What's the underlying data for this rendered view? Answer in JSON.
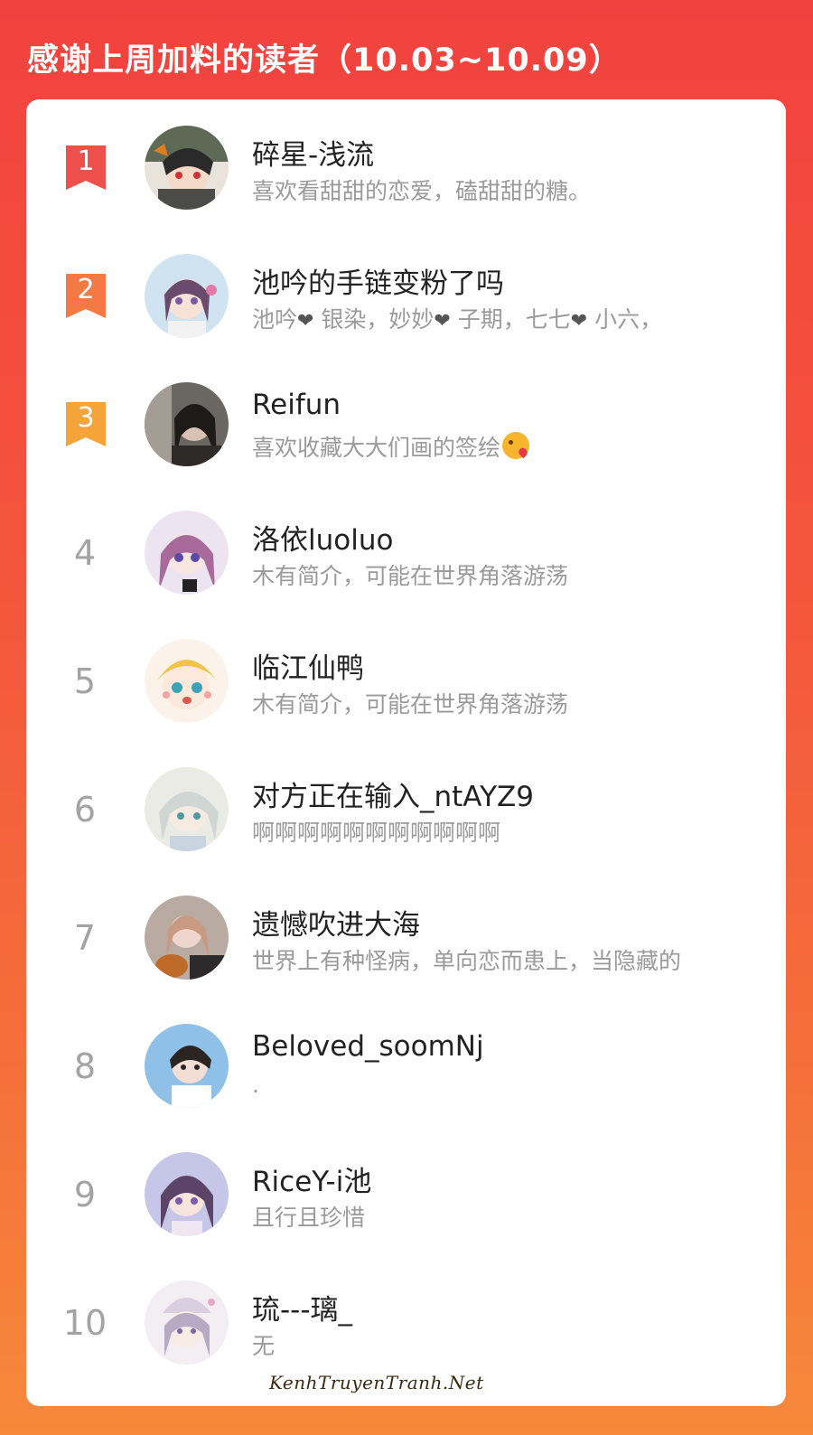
{
  "header": {
    "title": "感谢上周加料的读者（10.03~10.09）"
  },
  "colors": {
    "background_top": "#f2423f",
    "background_bottom": "#f7893a",
    "rank1": "#f0504c",
    "rank2": "#f37a45",
    "rank3": "#f5a43a",
    "name_text": "#222222",
    "desc_text": "#9a9a9a",
    "rank_text": "#a3a3a3"
  },
  "readers": [
    {
      "rank": "1",
      "name": "碎星-浅流",
      "desc": "喜欢看甜甜的恋爱，磕甜甜的糖。"
    },
    {
      "rank": "2",
      "name": "池吟的手链变粉了吗",
      "desc_parts": [
        "池吟",
        "❤",
        " 银染，妙妙",
        "❤",
        " 子期，七七",
        "❤",
        " 小六，"
      ]
    },
    {
      "rank": "3",
      "name": "Reifun",
      "desc": "喜欢收藏大大们画的签绘",
      "desc_emoji": "face-blowing-kiss-emoji"
    },
    {
      "rank": "4",
      "name": "洛依luoluo",
      "desc": "木有简介，可能在世界角落游荡"
    },
    {
      "rank": "5",
      "name": "临江仙鸭",
      "desc": "木有简介，可能在世界角落游荡"
    },
    {
      "rank": "6",
      "name": "对方正在输入_ntAYZ9",
      "desc": "啊啊啊啊啊啊啊啊啊啊啊"
    },
    {
      "rank": "7",
      "name": "遗憾吹进大海",
      "desc": "世界上有种怪病，单向恋而患上，当隐藏的"
    },
    {
      "rank": "8",
      "name": "Beloved_soomNj",
      "desc": "."
    },
    {
      "rank": "9",
      "name": "RiceY-i池",
      "desc": "且行且珍惜"
    },
    {
      "rank": "10",
      "name": "琉---璃_",
      "desc": "无"
    }
  ],
  "watermark": "KenhTruyenTranh.Net"
}
